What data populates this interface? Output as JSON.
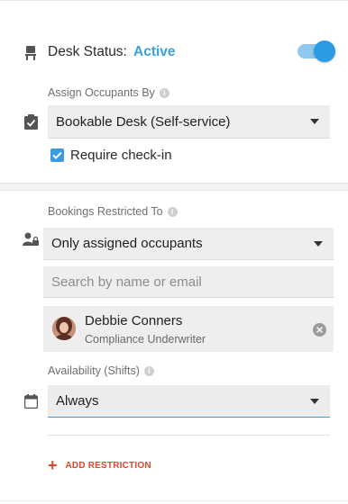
{
  "desk_status": {
    "label": "Desk Status:",
    "value": "Active",
    "value_color": "#3ba0e0",
    "toggle_on": true
  },
  "assign": {
    "label": "Assign Occupants By",
    "selected": "Bookable Desk (Self-service)"
  },
  "checkin": {
    "label": "Require check-in",
    "checked": true
  },
  "bookings": {
    "label": "Bookings Restricted To",
    "selected": "Only assigned occupants",
    "search_placeholder": "Search by name or email"
  },
  "occupant": {
    "name": "Debbie Conners",
    "title": "Compliance Underwriter"
  },
  "availability": {
    "label": "Availability (Shifts)",
    "selected": "Always"
  },
  "add_restriction": {
    "label": "ADD RESTRICTION",
    "color": "#d9472b"
  },
  "icons": [
    "desk-chair-icon",
    "clipboard-check-icon",
    "person-lock-icon",
    "calendar-icon",
    "info-icon",
    "clear-icon",
    "plus-icon"
  ]
}
